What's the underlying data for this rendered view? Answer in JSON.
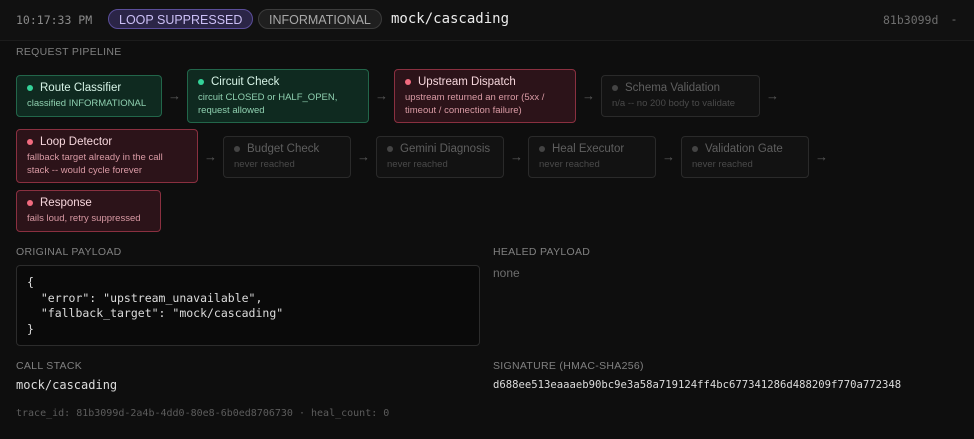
{
  "header": {
    "time": "10:17:33 PM",
    "badge_primary": "LOOP SUPPRESSED",
    "badge_secondary": "INFORMATIONAL",
    "route": "mock/cascading",
    "trace_short": "81b3099d",
    "dash": "-"
  },
  "pipeline": {
    "label": "REQUEST PIPELINE",
    "arrow": "→",
    "steps": [
      {
        "title": "Route Classifier",
        "desc": "classified INFORMATIONAL",
        "status": "ok"
      },
      {
        "title": "Circuit Check",
        "desc": "circuit CLOSED or HALF_OPEN, request allowed",
        "status": "ok"
      },
      {
        "title": "Upstream Dispatch",
        "desc": "upstream returned an error (5xx / timeout / connection failure)",
        "status": "error"
      },
      {
        "title": "Schema Validation",
        "desc": "n/a -- no 200 body to validate",
        "status": "skipped"
      },
      {
        "title": "Loop Detector",
        "desc": "fallback target already in the call stack -- would cycle forever",
        "status": "error"
      },
      {
        "title": "Budget Check",
        "desc": "never reached",
        "status": "skipped"
      },
      {
        "title": "Gemini Diagnosis",
        "desc": "never reached",
        "status": "skipped"
      },
      {
        "title": "Heal Executor",
        "desc": "never reached",
        "status": "skipped"
      },
      {
        "title": "Validation Gate",
        "desc": "never reached",
        "status": "skipped"
      },
      {
        "title": "Response",
        "desc": "fails loud, retry suppressed",
        "status": "error"
      }
    ]
  },
  "original_payload": {
    "label": "ORIGINAL PAYLOAD",
    "body": "{\n  \"error\": \"upstream_unavailable\",\n  \"fallback_target\": \"mock/cascading\"\n}"
  },
  "healed_payload": {
    "label": "HEALED PAYLOAD",
    "value": "none"
  },
  "call_stack": {
    "label": "CALL STACK",
    "value": "mock/cascading"
  },
  "signature": {
    "label": "SIGNATURE (HMAC-SHA256)",
    "value": "d688ee513eaaaeb90bc9e3a58a719124ff4bc677341286d488209f770a772348"
  },
  "footer": "trace_id: 81b3099d-2a4b-4dd0-80e8-6b0ed8706730 · heal_count: 0",
  "colors": {
    "ok": "#34d399",
    "error": "#f26b7f",
    "skipped": "#444444",
    "loop_badge": "#5b4e9a"
  }
}
